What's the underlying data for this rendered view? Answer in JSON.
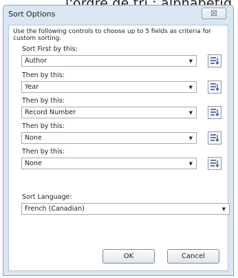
{
  "background": {
    "fragment": "l'ordre de tri : alphabétiq"
  },
  "dialog": {
    "title": "Sort Options",
    "close_label": "☒",
    "intro": "Use the following controls to choose up to 5 fields as criteria for custom sorting.",
    "sort_fields": [
      {
        "label": "Sort First by this:",
        "value": "Author"
      },
      {
        "label": "Then by this:",
        "value": "Year"
      },
      {
        "label": "Then by this:",
        "value": "Record Number"
      },
      {
        "label": "Then by this:",
        "value": "None"
      },
      {
        "label": "Then by this:",
        "value": "None"
      }
    ],
    "language": {
      "label": "Sort Language:",
      "value": "French (Canadian)"
    },
    "buttons": {
      "ok": "OK",
      "cancel": "Cancel"
    },
    "dropdown_arrow": "▼",
    "colors": {
      "frame": "#d9e6f4",
      "border": "#8fa2ba",
      "client": "#ffffff"
    }
  }
}
